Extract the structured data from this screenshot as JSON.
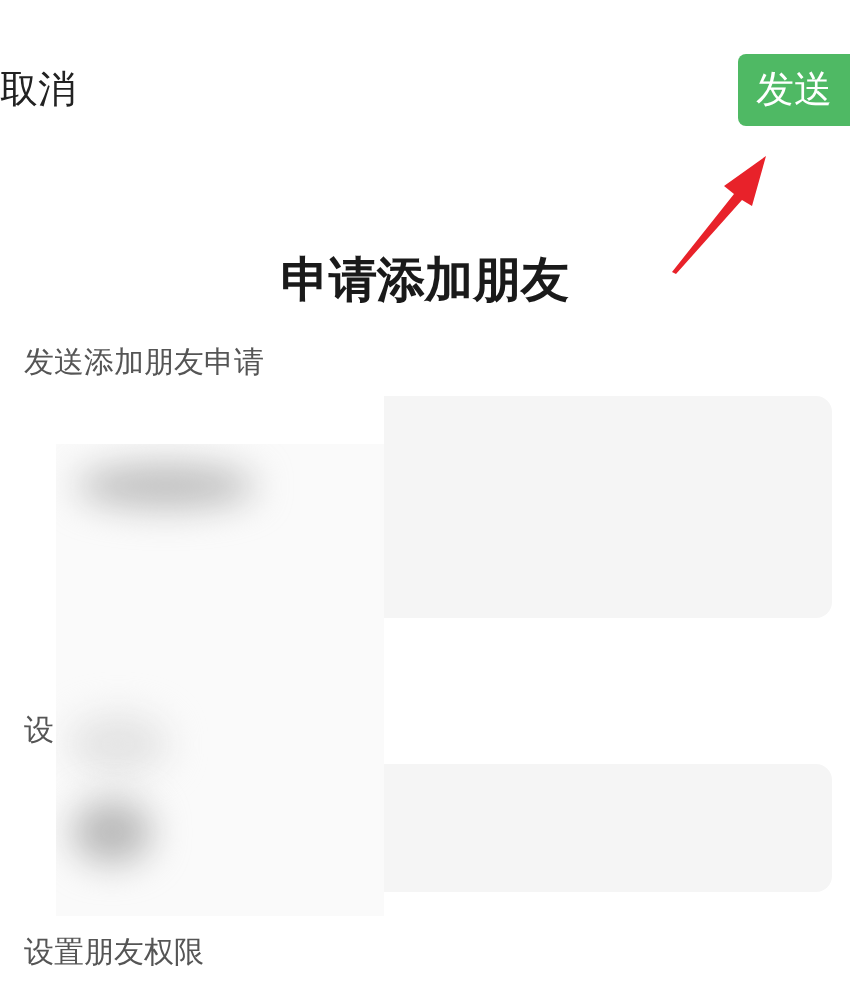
{
  "header": {
    "cancel": "取消",
    "send_button": "发送"
  },
  "title": "申请添加朋友",
  "sections": [
    {
      "label": "发送添加朋友申请",
      "kind": "tall"
    },
    {
      "label": "设",
      "kind": "short"
    },
    {
      "label": "设置朋友权限",
      "kind": "none"
    }
  ]
}
